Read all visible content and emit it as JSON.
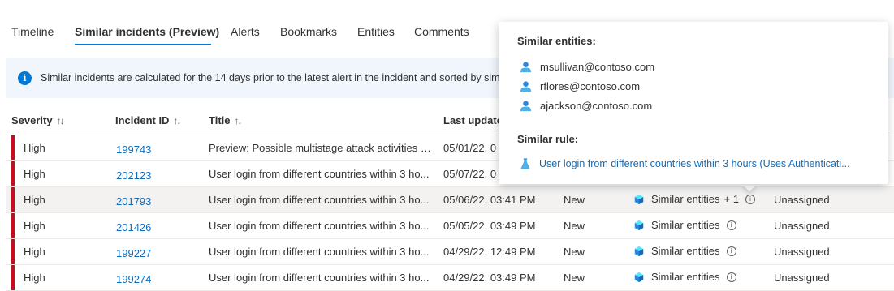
{
  "tabs": [
    {
      "label": "Timeline"
    },
    {
      "label": "Similar incidents (Preview)"
    },
    {
      "label": "Alerts"
    },
    {
      "label": "Bookmarks"
    },
    {
      "label": "Entities"
    },
    {
      "label": "Comments"
    }
  ],
  "active_tab": "Similar incidents (Preview)",
  "info": {
    "icon": "info-icon",
    "text": "Similar incidents are calculated for the 14 days prior to the latest alert in the incident and sorted by similarit"
  },
  "columns": {
    "severity": "Severity",
    "incident_id": "Incident ID",
    "title": "Title",
    "last_update": "Last update"
  },
  "rows": [
    {
      "severity": "High",
      "id": "199743",
      "title": "Preview: Possible multistage attack activities de...",
      "date": "05/01/22, 0",
      "status": "",
      "similarity": "",
      "plus": "",
      "owner": ""
    },
    {
      "severity": "High",
      "id": "202123",
      "title": "User login from different countries within 3 ho...",
      "date": "05/07/22, 0",
      "status": "",
      "similarity": "",
      "plus": "",
      "owner": ""
    },
    {
      "severity": "High",
      "id": "201793",
      "title": "User login from different countries within 3 ho...",
      "date": "05/06/22, 03:41 PM",
      "status": "New",
      "similarity": "Similar entities",
      "plus": "+ 1",
      "owner": "Unassigned"
    },
    {
      "severity": "High",
      "id": "201426",
      "title": "User login from different countries within 3 ho...",
      "date": "05/05/22, 03:49 PM",
      "status": "New",
      "similarity": "Similar entities",
      "plus": "",
      "owner": "Unassigned"
    },
    {
      "severity": "High",
      "id": "199227",
      "title": "User login from different countries within 3 ho...",
      "date": "04/29/22, 12:49 PM",
      "status": "New",
      "similarity": "Similar entities",
      "plus": "",
      "owner": "Unassigned"
    },
    {
      "severity": "High",
      "id": "199274",
      "title": "User login from different countries within 3 ho...",
      "date": "04/29/22, 03:49 PM",
      "status": "New",
      "similarity": "Similar entities",
      "plus": "",
      "owner": "Unassigned"
    }
  ],
  "popover": {
    "entities_heading": "Similar entities:",
    "users": [
      "msullivan@contoso.com",
      "rflores@contoso.com",
      "ajackson@contoso.com"
    ],
    "rule_heading": "Similar rule:",
    "rule": "User login from different countries within 3 hours (Uses Authenticati..."
  },
  "colors": {
    "accent": "#0078d4",
    "link": "#0f6cbd",
    "severity_high": "#c50f1f",
    "info_bg": "#f0f6fc"
  }
}
